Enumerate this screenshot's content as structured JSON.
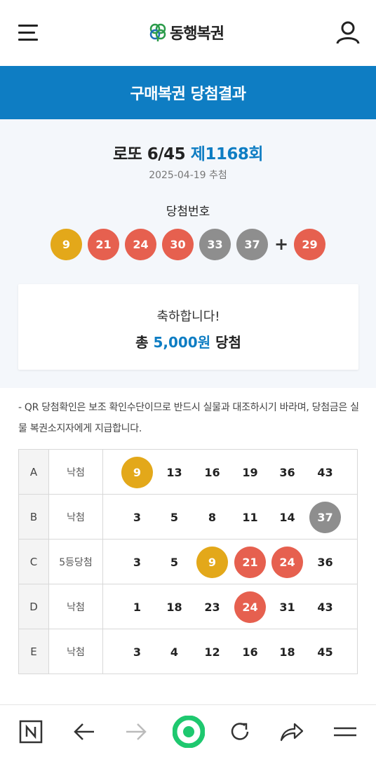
{
  "header": {
    "logo_text": "동행복권",
    "menu_icon": "hamburger-menu-icon",
    "user_icon": "user-icon"
  },
  "page_title": "구매복권 당첨결과",
  "draw": {
    "game_name": "로또 6/45",
    "round": "제1168회",
    "date": "2025-04-19 추첨",
    "winning_label": "당첨번호",
    "numbers": [
      "9",
      "21",
      "24",
      "30",
      "33",
      "37"
    ],
    "plus": "+",
    "bonus": "29"
  },
  "prize": {
    "message": "축하합니다!",
    "total_prefix": "총",
    "amount": "5,000원",
    "total_suffix": "당첨"
  },
  "notice": "- QR 당첨확인은 보조 확인수단이므로 반드시 실물과 대조하시기 바라며, 당첨금은 실물 복권소지자에게 지급합니다.",
  "games": [
    {
      "label": "A",
      "result": "낙첨",
      "numbers": [
        "9",
        "13",
        "16",
        "19",
        "36",
        "43"
      ],
      "hits": [
        "yellow",
        "",
        "",
        "",
        "",
        ""
      ]
    },
    {
      "label": "B",
      "result": "낙첨",
      "numbers": [
        "3",
        "5",
        "8",
        "11",
        "14",
        "37"
      ],
      "hits": [
        "",
        "",
        "",
        "",
        "",
        "gray"
      ]
    },
    {
      "label": "C",
      "result": "5등당첨",
      "numbers": [
        "3",
        "5",
        "9",
        "21",
        "24",
        "36"
      ],
      "hits": [
        "",
        "",
        "yellow",
        "red",
        "red",
        ""
      ]
    },
    {
      "label": "D",
      "result": "낙첨",
      "numbers": [
        "1",
        "18",
        "23",
        "24",
        "31",
        "43"
      ],
      "hits": [
        "",
        "",
        "",
        "red",
        "",
        ""
      ]
    },
    {
      "label": "E",
      "result": "낙첨",
      "numbers": [
        "3",
        "4",
        "12",
        "16",
        "18",
        "45"
      ],
      "hits": [
        "",
        "",
        "",
        "",
        "",
        ""
      ]
    }
  ],
  "colors": {
    "brand_blue": "#0e7dc3",
    "ball_yellow": "#e3a81a",
    "ball_red": "#e6604f",
    "ball_gray": "#8e8e8e",
    "browser_green": "#1ec86f"
  },
  "browser_bar": {
    "icons": [
      "naver-n-icon",
      "back-arrow-icon",
      "forward-arrow-icon",
      "home-green-icon",
      "refresh-icon",
      "share-icon",
      "more-menu-icon"
    ]
  }
}
